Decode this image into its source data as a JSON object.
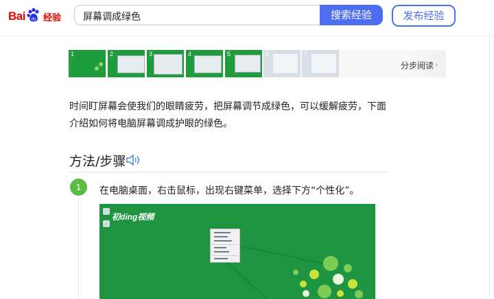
{
  "header": {
    "logo_bai": "Bai",
    "logo_du": "du",
    "logo_suffix": "经验",
    "search_value": "屏幕调成绿色",
    "search_button": "搜索经验",
    "publish_button": "发布经验"
  },
  "thumbnails": {
    "numbers": [
      "1",
      "2",
      "3",
      "4",
      "5",
      "6",
      "7"
    ],
    "steps_read": "分步阅读",
    "chevron": "›"
  },
  "intro": "时间盯屏幕会使我们的眼睛疲劳，把屏幕调节成绿色，可以缓解疲劳，下面介绍如何将电脑屏幕调成护眼的绿色。",
  "method": {
    "title": "方法/步骤"
  },
  "step": {
    "number": "1",
    "text": "在电脑桌面，右击鼠标，出现右键菜单，选择下方“个性化”。",
    "watermark": "初ding视频"
  },
  "colors": {
    "accent": "#4e6ef2",
    "baidu_red": "#e10601",
    "baidu_blue": "#2932e1",
    "step_green": "#5abc43",
    "desktop_green": "#1f9440"
  }
}
